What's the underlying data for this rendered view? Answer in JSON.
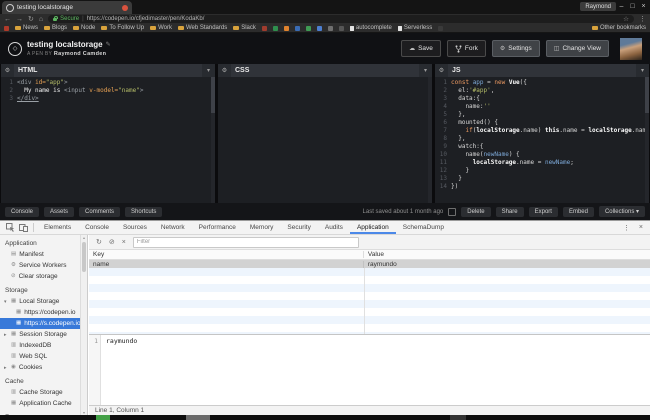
{
  "icons": {
    "arrow-down": "▾",
    "arrow-right": "▸",
    "table": "▦",
    "document": "▤",
    "gear": "⚙",
    "database": "▥",
    "cookie": "◉",
    "clear": "⊘",
    "cloud": "☁",
    "pencil": "✎",
    "chevron": "▾",
    "back": "←",
    "forward": "→",
    "reload": "↻",
    "home": "⌂",
    "star": "☆",
    "overflow": "⋮",
    "min": "–",
    "max": "□",
    "close": "×",
    "block": "⊘",
    "x": "×",
    "logo": "◇",
    "view": "◫",
    "up": "▴",
    "down": "▾"
  },
  "browser": {
    "tab_title": "testing localstorage",
    "profile": "Raymond",
    "url": {
      "secure_label": "Secure",
      "separator": "|",
      "address": "https://codepen.io/cfjedimaster/pen/KodaKb/"
    },
    "bookmarks": {
      "items": [
        {
          "type": "favicon",
          "name": "red-site-favicon",
          "color": "#b03a2a"
        },
        {
          "type": "folder",
          "label": "News"
        },
        {
          "type": "folder",
          "label": "Blogs"
        },
        {
          "type": "folder",
          "label": "Node"
        },
        {
          "type": "folder",
          "label": "To Follow Up"
        },
        {
          "type": "folder",
          "label": "Work"
        },
        {
          "type": "folder",
          "label": "Web Standards"
        },
        {
          "type": "folder",
          "label": "Slack"
        },
        {
          "type": "favicon",
          "name": "maroon-favicon",
          "color": "#a03c2e"
        },
        {
          "type": "favicon",
          "name": "green-favicon",
          "color": "#2f8f4e"
        },
        {
          "type": "favicon",
          "name": "analytics-favicon",
          "color": "#e0832e"
        },
        {
          "type": "favicon",
          "name": "blue-favicon",
          "color": "#3a6cb4"
        },
        {
          "type": "favicon",
          "name": "sheets-favicon",
          "color": "#3f9b54"
        },
        {
          "type": "favicon",
          "name": "mail-favicon",
          "color": "#4d7fd0"
        },
        {
          "type": "favicon",
          "name": "clock-favicon",
          "color": "#6f6f6f"
        },
        {
          "type": "favicon",
          "name": "grey-favicon",
          "color": "#565656"
        },
        {
          "type": "page",
          "label": "autocomplete"
        },
        {
          "type": "page",
          "label": "Serverless"
        },
        {
          "type": "favicon",
          "name": "dim-favicon",
          "color": "#3a3a3a"
        }
      ],
      "other_label": "Other bookmarks"
    }
  },
  "codepen": {
    "pen_title": "testing localstorage",
    "byline_prefix": "A PEN BY",
    "author": "Raymond Camden",
    "buttons": {
      "save": "Save",
      "fork": "Fork",
      "settings": "Settings",
      "change_view": "Change View"
    },
    "editors": [
      {
        "label": "HTML",
        "lines": [
          [
            [
              "tag",
              "<div "
            ],
            [
              "attr",
              "id="
            ],
            [
              "str",
              "\"app\""
            ],
            [
              "tag",
              ">"
            ]
          ],
          [
            [
              "txt",
              "  My name is "
            ],
            [
              "tag",
              "<input "
            ],
            [
              "attr",
              "v-model="
            ],
            [
              "str",
              "\"name\""
            ],
            [
              "tag",
              ">"
            ]
          ],
          [
            [
              "tagu",
              "</div>"
            ]
          ]
        ]
      },
      {
        "label": "CSS",
        "lines": []
      },
      {
        "label": "JS",
        "lines": [
          [
            [
              "kw",
              "const "
            ],
            [
              "var",
              "app"
            ],
            [
              "p",
              " = "
            ],
            [
              "kw",
              "new "
            ],
            [
              "bold",
              "Vue"
            ],
            [
              "p",
              "({"
            ]
          ],
          [
            [
              "p",
              "  el:"
            ],
            [
              "str",
              "'#app'"
            ],
            [
              "p",
              ","
            ]
          ],
          [
            [
              "p",
              "  data:{"
            ]
          ],
          [
            [
              "p",
              "    name:"
            ],
            [
              "str",
              "''"
            ]
          ],
          [
            [
              "p",
              "  },"
            ]
          ],
          [
            [
              "p",
              "  mounted() {"
            ]
          ],
          [
            [
              "p",
              "    "
            ],
            [
              "kw",
              "if"
            ],
            [
              "p",
              "("
            ],
            [
              "bold",
              "localStorage"
            ],
            [
              "p",
              ".name) "
            ],
            [
              "bold",
              "this"
            ],
            [
              "p",
              ".name = "
            ],
            [
              "bold",
              "localStorage"
            ],
            [
              "p",
              ".name;"
            ]
          ],
          [
            [
              "p",
              "  },"
            ]
          ],
          [
            [
              "p",
              "  watch:{"
            ]
          ],
          [
            [
              "p",
              "    name("
            ],
            [
              "var",
              "newName"
            ],
            [
              "p",
              ") {"
            ]
          ],
          [
            [
              "p",
              "      "
            ],
            [
              "bold",
              "localStorage"
            ],
            [
              "p",
              ".name = "
            ],
            [
              "var",
              "newName"
            ],
            [
              "p",
              ";"
            ]
          ],
          [
            [
              "p",
              "    }"
            ]
          ],
          [
            [
              "p",
              "  }"
            ]
          ],
          [
            [
              "p",
              "})"
            ]
          ]
        ]
      }
    ],
    "footer": {
      "left_buttons": [
        "Console",
        "Assets",
        "Comments",
        "Shortcuts"
      ],
      "saved_text": "Last saved about 1 month ago",
      "right_buttons": [
        {
          "label": "Delete"
        },
        {
          "label": "Share"
        },
        {
          "label": "Export"
        },
        {
          "label": "Embed"
        },
        {
          "label": "Collections",
          "caret": true
        }
      ]
    }
  },
  "devtools": {
    "tabs": [
      "Elements",
      "Console",
      "Sources",
      "Network",
      "Performance",
      "Memory",
      "Security",
      "Audits",
      "Application",
      "SchemaDump"
    ],
    "selected_tab": "Application",
    "sidebar": {
      "sections": [
        {
          "title": "Application",
          "items": [
            {
              "label": "Manifest",
              "icon": "document"
            },
            {
              "label": "Service Workers",
              "icon": "gear"
            },
            {
              "label": "Clear storage",
              "icon": "clear"
            }
          ]
        },
        {
          "title": "Storage",
          "items": [
            {
              "label": "Local Storage",
              "icon": "table",
              "arrow": "down"
            },
            {
              "label": "https://codepen.io",
              "icon": "table",
              "indent": true
            },
            {
              "label": "https://s.codepen.io",
              "icon": "table",
              "indent": true,
              "selected": true
            },
            {
              "label": "Session Storage",
              "icon": "table",
              "arrow": "right"
            },
            {
              "label": "IndexedDB",
              "icon": "database"
            },
            {
              "label": "Web SQL",
              "icon": "database"
            },
            {
              "label": "Cookies",
              "icon": "cookie",
              "arrow": "right"
            }
          ]
        },
        {
          "title": "Cache",
          "items": [
            {
              "label": "Cache Storage",
              "icon": "database"
            },
            {
              "label": "Application Cache",
              "icon": "table"
            }
          ]
        },
        {
          "title": "Frames",
          "items": []
        }
      ]
    },
    "toolbar": {
      "filter_placeholder": "Filter"
    },
    "table": {
      "headers": [
        "Key",
        "Value"
      ],
      "rows": [
        {
          "key": "name",
          "value": "raymundo",
          "selected": true
        }
      ]
    },
    "preview": {
      "line": "1",
      "value": "raymundo"
    },
    "status_bar": "Line 1, Column 1"
  }
}
